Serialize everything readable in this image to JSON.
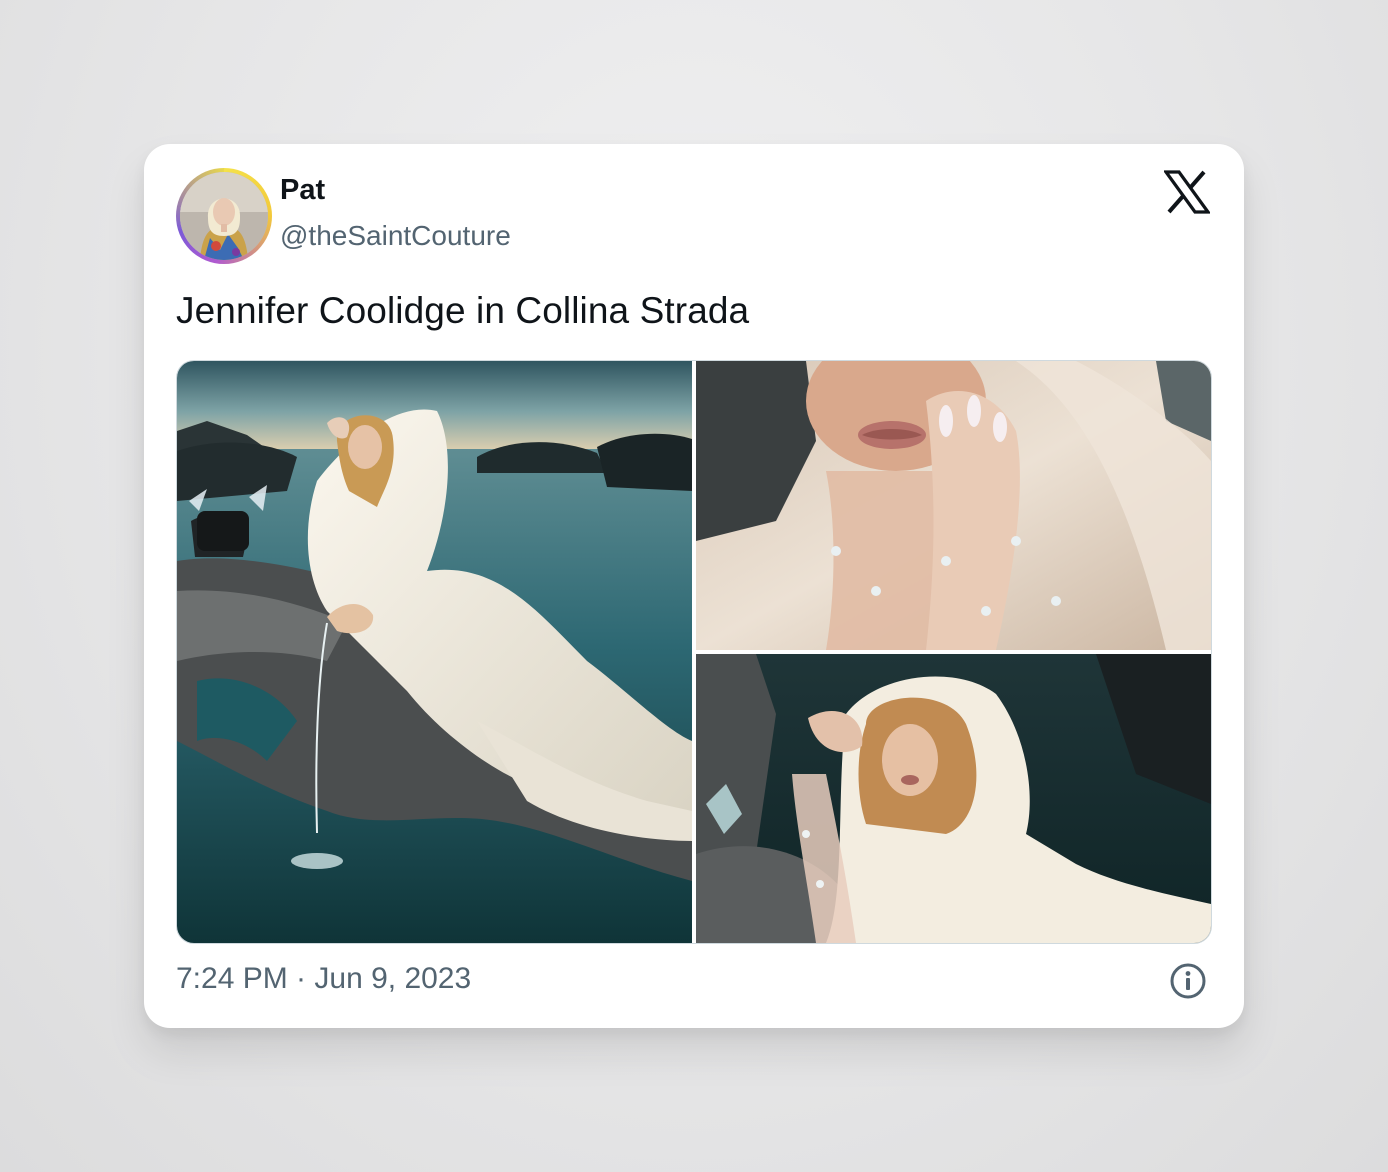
{
  "tweet": {
    "author": {
      "display_name": "Pat",
      "handle": "@theSaintCouture",
      "avatar_icon": "profile-photo"
    },
    "platform_icon": "x-logo-icon",
    "text": "Jennifer Coolidge in Collina Strada",
    "media": [
      {
        "icon": "photo-seaside-reclining-white-gown"
      },
      {
        "icon": "photo-closeup-jeweled-gloves"
      },
      {
        "icon": "photo-seashell-white-veil"
      }
    ],
    "timestamp": "7:24 PM · Jun 9, 2023",
    "info_icon": "info-circle-icon"
  },
  "colors": {
    "text_primary": "#0f1419",
    "text_secondary": "#536471",
    "card_background": "#ffffff",
    "page_background": "#e6e6e7",
    "media_border": "#cfd9de"
  }
}
